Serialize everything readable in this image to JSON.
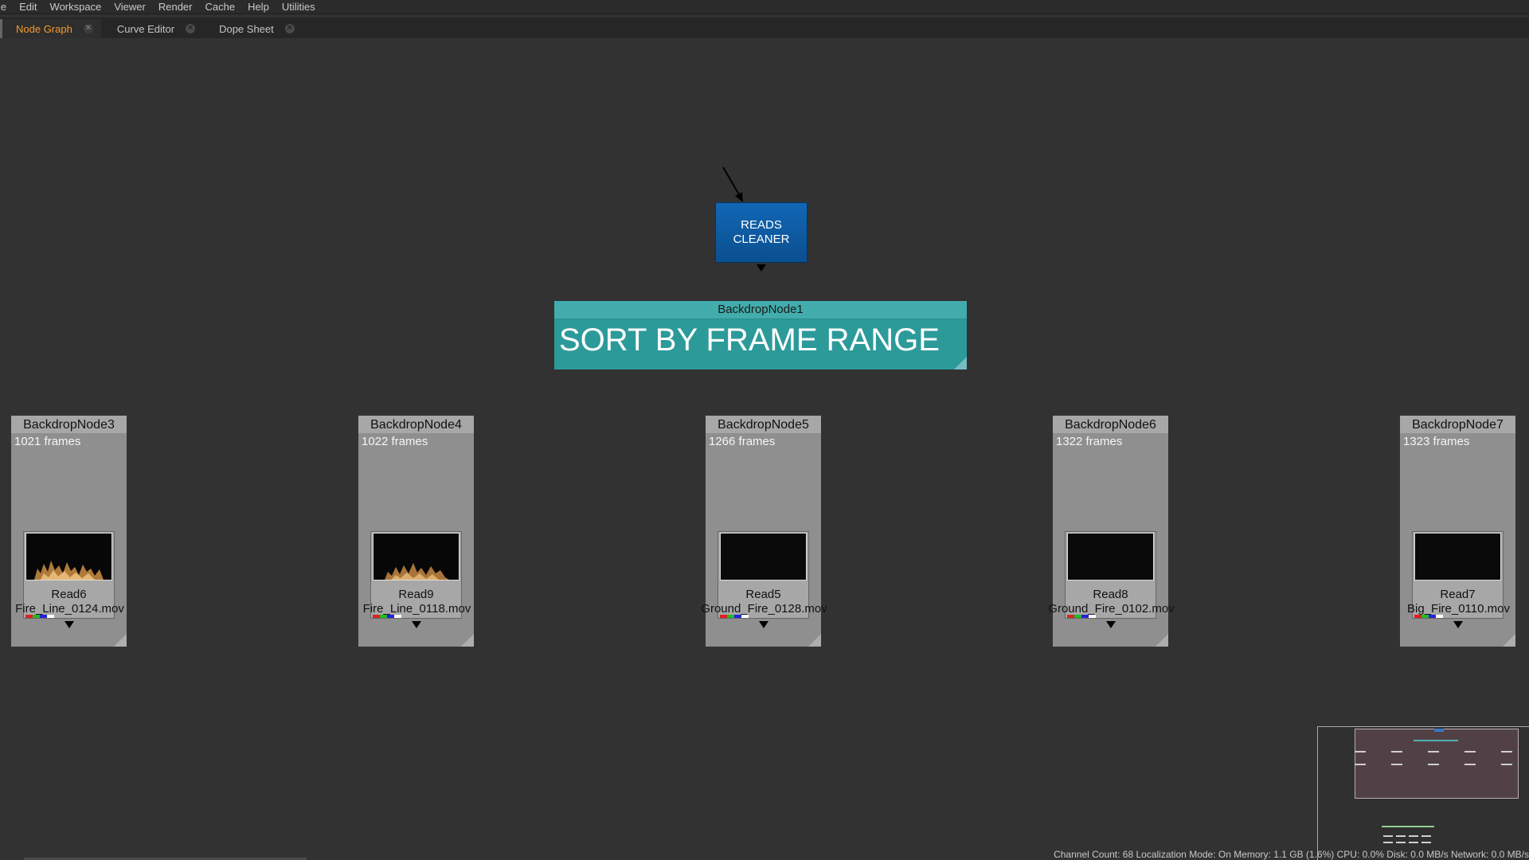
{
  "menu": [
    "le",
    "Edit",
    "Workspace",
    "Viewer",
    "Render",
    "Cache",
    "Help",
    "Utilities"
  ],
  "tabs": [
    {
      "label": "Node Graph",
      "active": true
    },
    {
      "label": "Curve Editor",
      "active": false
    },
    {
      "label": "Dope Sheet",
      "active": false
    }
  ],
  "reads_cleaner": {
    "line1": "READS",
    "line2": "CLEANER",
    "color": "#0f62ad"
  },
  "main_backdrop": {
    "title": "BackdropNode1",
    "label": "SORT BY FRAME RANGE",
    "color": "#2d9a9a"
  },
  "backdrops": [
    {
      "title": "BackdropNode3",
      "frames": "1021 frames",
      "read_name": "Read6",
      "file": "Fire_Line_0124.mov",
      "thumb": "fire"
    },
    {
      "title": "BackdropNode4",
      "frames": "1022 frames",
      "read_name": "Read9",
      "file": "Fire_Line_0118.mov",
      "thumb": "fire"
    },
    {
      "title": "BackdropNode5",
      "frames": "1266 frames",
      "read_name": "Read5",
      "file": "Ground_Fire_0128.mov",
      "thumb": "black"
    },
    {
      "title": "BackdropNode6",
      "frames": "1322 frames",
      "read_name": "Read8",
      "file": "Ground_Fire_0102.mov",
      "thumb": "black"
    },
    {
      "title": "BackdropNode7",
      "frames": "1323 frames",
      "read_name": "Read7",
      "file": "Big_Fire_0110.mov",
      "thumb": "black"
    }
  ],
  "status": "Channel Count: 68  Localization Mode: On  Memory: 1.1 GB (1.6%)  CPU: 0.0%  Disk: 0.0 MB/s  Network: 0.0 MB/s"
}
